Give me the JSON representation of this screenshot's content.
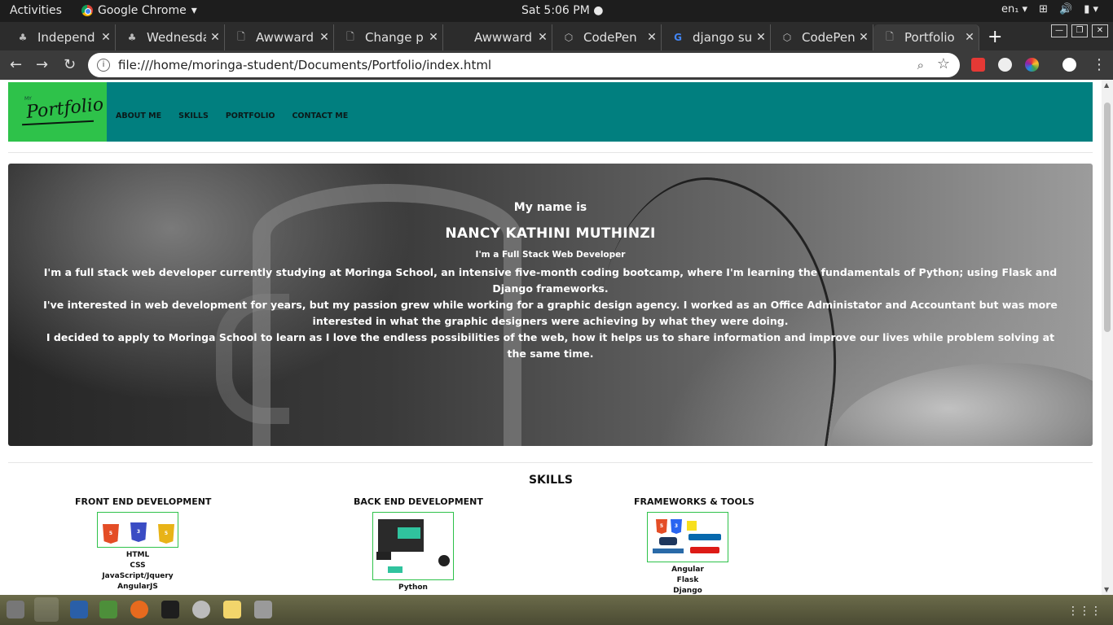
{
  "system_bar": {
    "activities": "Activities",
    "app_name": "Google Chrome",
    "clock": "Sat  5:06 PM",
    "lang": "en₁"
  },
  "tabs": [
    {
      "title": "Independ",
      "active": false
    },
    {
      "title": "Wednesda",
      "active": false
    },
    {
      "title": "Awwward",
      "active": false
    },
    {
      "title": "Change pr",
      "active": false
    },
    {
      "title": "Awwward",
      "active": false
    },
    {
      "title": "CodePen",
      "active": false
    },
    {
      "title": "django su",
      "active": false
    },
    {
      "title": "CodePen",
      "active": false
    },
    {
      "title": "Portfolio",
      "active": true
    }
  ],
  "address_bar": {
    "url": "file:///home/moringa-student/Documents/Portfolio/index.html"
  },
  "site": {
    "logo_small": "MY",
    "logo_word": "Portfolio",
    "nav": [
      "ABOUT ME",
      "SKILLS",
      "PORTFOLIO",
      "CONTACT ME"
    ],
    "hero": {
      "intro": "My name is",
      "name": "NANCY KATHINI MUTHINZI",
      "role": "I'm a Full Stack Web Developer",
      "bio1": "I'm a full stack web developer currently studying at Moringa School, an intensive five-month coding bootcamp, where I'm learning the fundamentals of Python; using Flask and Django frameworks.",
      "bio2": "I've interested in web development for years, but my passion grew while working for a graphic design agency. I worked as an Office Administator and Accountant but was more interested in what the graphic designers were achieving by what they were doing.",
      "bio3": "I decided to apply to Moringa School to learn as I love the endless possibilities of the web, how it helps us to share information and improve our lives while problem solving at the same time."
    },
    "skills": {
      "title": "SKILLS",
      "front": {
        "heading": "FRONT END DEVELOPMENT",
        "items": [
          "HTML",
          "CSS",
          "JavaScript/Jquery",
          "AngularJS"
        ]
      },
      "back": {
        "heading": "BACK END DEVELOPMENT",
        "items": [
          "Python"
        ]
      },
      "tools": {
        "heading": "FRAMEWORKS & TOOLS",
        "items": [
          "Angular",
          "Flask",
          "Django"
        ]
      }
    }
  },
  "colors": {
    "nav_bg": "#017f7f",
    "logo_bg": "#2ec24a"
  }
}
